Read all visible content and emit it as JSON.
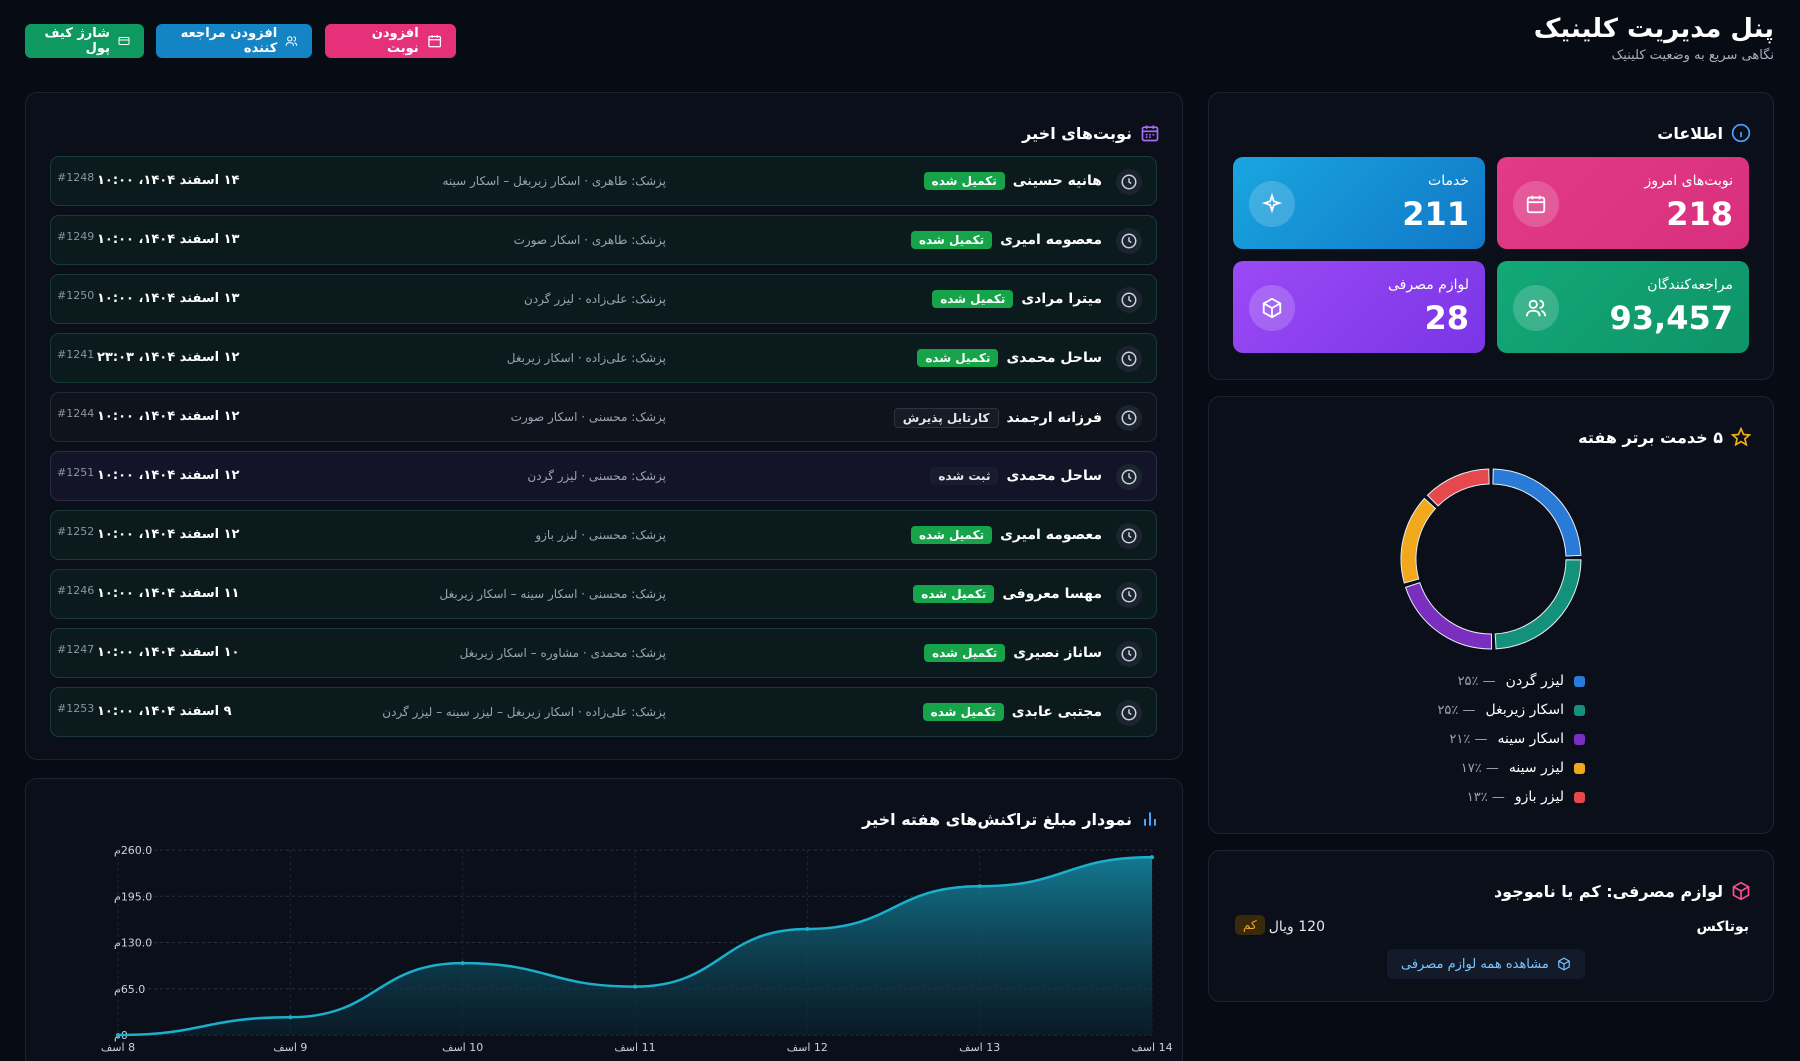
{
  "header": {
    "title": "پنل مدیریت کلینیک",
    "subtitle": "نگاهی سریع به وضعیت کلینیک",
    "buttons": {
      "add_appointment": "افزودن نوبت",
      "add_client": "افزودن مراجعه کننده",
      "charge_wallet": "شارژ کیف پول"
    }
  },
  "info": {
    "title": "اطلاعات",
    "stats": [
      {
        "label": "نوبت‌های امروز",
        "value": "218",
        "color": "#e53e8f"
      },
      {
        "label": "خدمات",
        "value": "211",
        "color": "#1596d6"
      },
      {
        "label": "مراجعه‌کنندگان",
        "value": "93,457",
        "color": "#0fa371"
      },
      {
        "label": "لوازم مصرفی",
        "value": "28",
        "color": "#8a3df0"
      }
    ]
  },
  "appointments": {
    "title": "نوبت‌های اخیر",
    "rows": [
      {
        "name": "هانیه حسینی",
        "status": "تکمیل شده",
        "doctor": "پزشک: طاهری",
        "service": "اسکار زیربغل – اسکار سینه",
        "date": "۱۴ اسفند ۱۴۰۴، ۱۰:۰۰",
        "id": "#1248"
      },
      {
        "name": "معصومه امیری",
        "status": "تکمیل شده",
        "doctor": "پزشک: طاهری",
        "service": "اسکار صورت",
        "date": "۱۳ اسفند ۱۴۰۴، ۱۰:۰۰",
        "id": "#1249"
      },
      {
        "name": "میترا مرادی",
        "status": "تکمیل شده",
        "doctor": "پزشک: علی‌زاده",
        "service": "لیزر گردن",
        "date": "۱۳ اسفند ۱۴۰۴، ۱۰:۰۰",
        "id": "#1250"
      },
      {
        "name": "ساحل محمدی",
        "status": "تکمیل شده",
        "doctor": "پزشک: علی‌زاده",
        "service": "اسکار زیربغل",
        "date": "۱۲ اسفند ۱۴۰۴، ۲۳:۰۳",
        "id": "#1241"
      },
      {
        "name": "فرزانه ارجمند",
        "status": "کارتابل پذیرش",
        "doctor": "پزشک: محسنی",
        "service": "اسکار صورت",
        "date": "۱۲ اسفند ۱۴۰۴، ۱۰:۰۰",
        "id": "#1244"
      },
      {
        "name": "ساحل محمدی",
        "status": "ثبت شده",
        "doctor": "پزشک: محسنی",
        "service": "لیزر گردن",
        "date": "۱۲ اسفند ۱۴۰۴، ۱۰:۰۰",
        "id": "#1251"
      },
      {
        "name": "معصومه امیری",
        "status": "تکمیل شده",
        "doctor": "پزشک: محسنی",
        "service": "لیزر بازو",
        "date": "۱۲ اسفند ۱۴۰۴، ۱۰:۰۰",
        "id": "#1252"
      },
      {
        "name": "مهسا معروفی",
        "status": "تکمیل شده",
        "doctor": "پزشک: محسنی",
        "service": "اسکار سینه – اسکار زیربغل",
        "date": "۱۱ اسفند ۱۴۰۴، ۱۰:۰۰",
        "id": "#1246"
      },
      {
        "name": "ساناز نصیری",
        "status": "تکمیل شده",
        "doctor": "پزشک: محمدی",
        "service": "مشاوره – اسکار زیربغل",
        "date": "۱۰ اسفند ۱۴۰۴، ۱۰:۰۰",
        "id": "#1247"
      },
      {
        "name": "مجتبی عابدی",
        "status": "تکمیل شده",
        "doctor": "پزشک: علی‌زاده",
        "service": "اسکار زیربغل – لیزر سینه – لیزر گردن",
        "date": "۹ اسفند ۱۴۰۴، ۱۰:۰۰",
        "id": "#1253"
      }
    ]
  },
  "top_services": {
    "title": "۵ خدمت برتر هفته",
    "items": [
      {
        "label": "لیزر گردن",
        "pct": "۲۵٪",
        "value": 25,
        "color": "#2a7bd8"
      },
      {
        "label": "اسکار زیربغل",
        "pct": "۲۵٪",
        "value": 25,
        "color": "#14917a"
      },
      {
        "label": "اسکار سینه",
        "pct": "۲۱٪",
        "value": 21,
        "color": "#7b2fbf"
      },
      {
        "label": "لیزر سینه",
        "pct": "۱۷٪",
        "value": 17,
        "color": "#f2a81d"
      },
      {
        "label": "لیزر بازو",
        "pct": "۱۳٪",
        "value": 13,
        "color": "#e5484d"
      }
    ]
  },
  "supplies": {
    "title": "لوازم مصرفی: کم یا ناموجود",
    "item_name": "بوتاکس",
    "item_qty": "120 ویال",
    "item_badge": "کم",
    "view_all": "مشاهده همه لوازم مصرفی"
  },
  "chart_data": {
    "type": "area",
    "title": "نمودار مبلغ تراکنش‌های هفته اخیر",
    "categories": [
      "8 اسف",
      "9 اسف",
      "10 اسف",
      "11 اسف",
      "12 اسف",
      "13 اسف",
      "14 اسف"
    ],
    "values": [
      0,
      25,
      101,
      68,
      149,
      209,
      250
    ],
    "yticks": [
      "0م",
      "65.0م",
      "130.0م",
      "195.0م",
      "260.0م"
    ],
    "ylim": [
      0,
      260
    ],
    "color": "#1ab0cc",
    "grid": true
  }
}
